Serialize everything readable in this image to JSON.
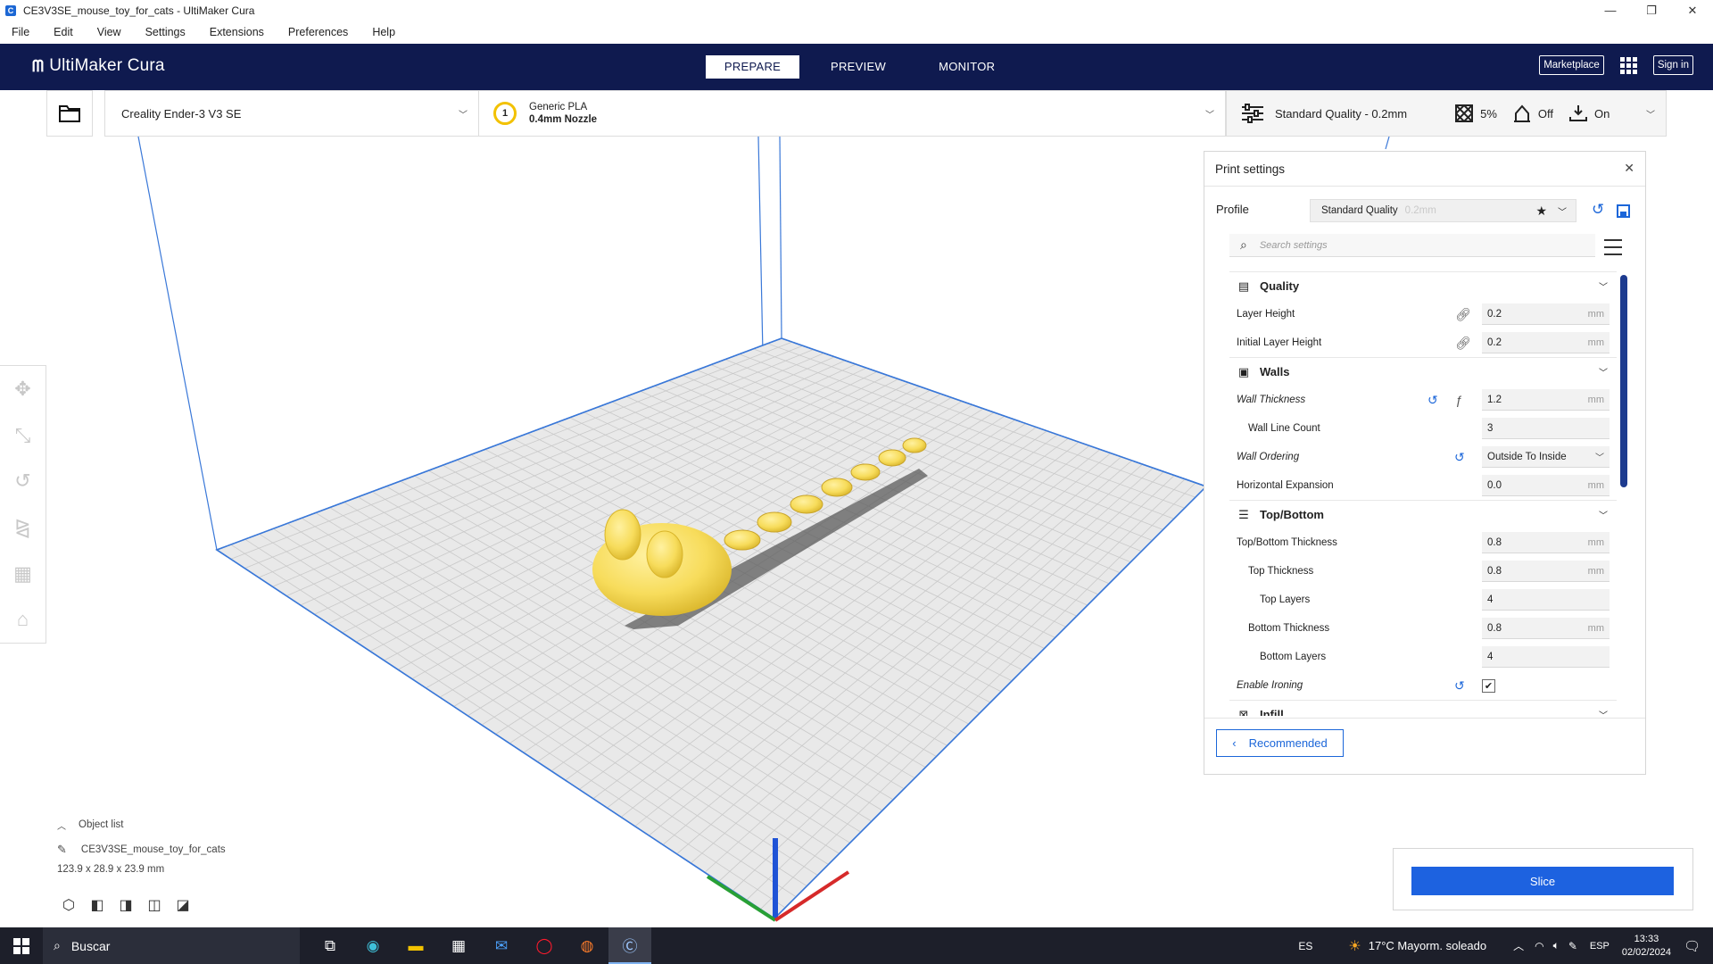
{
  "window": {
    "title": "CE3V3SE_mouse_toy_for_cats - UltiMaker Cura",
    "minimize": "—",
    "maximize": "❐",
    "close": "✕"
  },
  "menu": [
    "File",
    "Edit",
    "View",
    "Settings",
    "Extensions",
    "Preferences",
    "Help"
  ],
  "header": {
    "logo": "UltiMaker Cura",
    "tabs": [
      {
        "label": "PREPARE",
        "active": true
      },
      {
        "label": "PREVIEW",
        "active": false
      },
      {
        "label": "MONITOR",
        "active": false
      }
    ],
    "marketplace": "Marketplace",
    "sign_in": "Sign in"
  },
  "toolbar": {
    "printer": "Creality Ender-3 V3 SE",
    "material_badge": "1",
    "material_name": "Generic PLA",
    "nozzle": "0.4mm Nozzle",
    "quality": "Standard Quality - 0.2mm",
    "infill": "5%",
    "support": "Off",
    "adhesion": "On"
  },
  "object_list": {
    "title": "Object list",
    "object_name": "CE3V3SE_mouse_toy_for_cats",
    "dimensions": "123.9 x 28.9 x 23.9 mm"
  },
  "print_settings": {
    "title": "Print settings",
    "profile_label": "Profile",
    "profile_value": "Standard Quality",
    "profile_dim": "0.2mm",
    "search_placeholder": "Search settings",
    "categories": {
      "quality": "Quality",
      "walls": "Walls",
      "topbottom": "Top/Bottom",
      "infill": "Infill"
    },
    "rows": {
      "layer_height": {
        "label": "Layer Height",
        "value": "0.2",
        "unit": "mm"
      },
      "initial_layer_height": {
        "label": "Initial Layer Height",
        "value": "0.2",
        "unit": "mm"
      },
      "wall_thickness": {
        "label": "Wall Thickness",
        "value": "1.2",
        "unit": "mm"
      },
      "wall_line_count": {
        "label": "Wall Line Count",
        "value": "3"
      },
      "wall_ordering": {
        "label": "Wall Ordering",
        "value": "Outside To Inside"
      },
      "horizontal_expansion": {
        "label": "Horizontal Expansion",
        "value": "0.0",
        "unit": "mm"
      },
      "topbottom_thickness": {
        "label": "Top/Bottom Thickness",
        "value": "0.8",
        "unit": "mm"
      },
      "top_thickness": {
        "label": "Top Thickness",
        "value": "0.8",
        "unit": "mm"
      },
      "top_layers": {
        "label": "Top Layers",
        "value": "4"
      },
      "bottom_thickness": {
        "label": "Bottom Thickness",
        "value": "0.8",
        "unit": "mm"
      },
      "bottom_layers": {
        "label": "Bottom Layers",
        "value": "4"
      },
      "enable_ironing": {
        "label": "Enable Ironing",
        "checked": "✔"
      }
    },
    "recommended": "Recommended"
  },
  "slice": {
    "label": "Slice"
  },
  "taskbar": {
    "search": "Buscar",
    "lang_indicator": "ES",
    "weather": "17°C  Mayorm. soleado",
    "keyboard": "ESP",
    "time": "13:33",
    "date": "02/02/2024"
  },
  "colors": {
    "header": "#0f1a4f",
    "accent": "#1d62e0",
    "model": "#f7dc5b"
  }
}
